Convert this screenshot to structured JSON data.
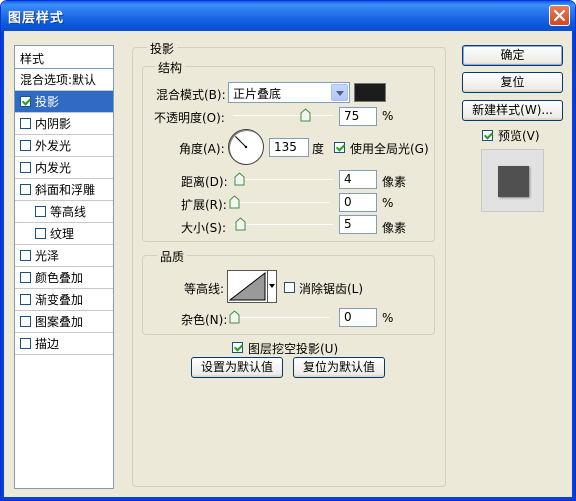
{
  "window": {
    "title": "图层样式"
  },
  "style_list": {
    "header": "样式",
    "blend_options": "混合选项:默认",
    "items": [
      {
        "label": "投影",
        "checked": true,
        "selected": true,
        "indent": false
      },
      {
        "label": "内阴影",
        "checked": false,
        "selected": false,
        "indent": false
      },
      {
        "label": "外发光",
        "checked": false,
        "selected": false,
        "indent": false
      },
      {
        "label": "内发光",
        "checked": false,
        "selected": false,
        "indent": false
      },
      {
        "label": "斜面和浮雕",
        "checked": false,
        "selected": false,
        "indent": false
      },
      {
        "label": "等高线",
        "checked": false,
        "selected": false,
        "indent": true
      },
      {
        "label": "纹理",
        "checked": false,
        "selected": false,
        "indent": true
      },
      {
        "label": "光泽",
        "checked": false,
        "selected": false,
        "indent": false
      },
      {
        "label": "颜色叠加",
        "checked": false,
        "selected": false,
        "indent": false
      },
      {
        "label": "渐变叠加",
        "checked": false,
        "selected": false,
        "indent": false
      },
      {
        "label": "图案叠加",
        "checked": false,
        "selected": false,
        "indent": false
      },
      {
        "label": "描边",
        "checked": false,
        "selected": false,
        "indent": false
      }
    ]
  },
  "drop_shadow": {
    "title": "投影",
    "structure": {
      "title": "结构",
      "blend_mode_label": "混合模式(B):",
      "blend_mode_value": "正片叠底",
      "shadow_color": "#1c1c1c",
      "opacity_label": "不透明度(O):",
      "opacity_value": "75",
      "opacity_unit": "%",
      "opacity_level": 75,
      "angle_label": "角度(A):",
      "angle_value": "135",
      "angle_unit": "度",
      "global_light_label": "使用全局光(G)",
      "global_light_checked": true,
      "distance_label": "距离(D):",
      "distance_value": "4",
      "distance_unit": "像素",
      "distance_level": 4,
      "spread_label": "扩展(R):",
      "spread_value": "0",
      "spread_unit": "%",
      "spread_level": 0,
      "size_label": "大小(S):",
      "size_value": "5",
      "size_unit": "像素",
      "size_level": 5
    },
    "quality": {
      "title": "品质",
      "contour_label": "等高线:",
      "anti_alias_label": "消除锯齿(L)",
      "anti_alias_checked": false,
      "noise_label": "杂色(N):",
      "noise_value": "0",
      "noise_unit": "%",
      "noise_level": 0
    },
    "knockout_label": "图层挖空投影(U)",
    "knockout_checked": true,
    "make_default_label": "设置为默认值",
    "reset_default_label": "复位为默认值"
  },
  "buttons": {
    "ok": "确定",
    "reset": "复位",
    "new_style": "新建样式(W)...",
    "preview_label": "预览(V)",
    "preview_checked": true
  },
  "icons": {
    "close": "close-icon",
    "angle_dial": "angle-dial-icon",
    "contour": "contour-curve-icon",
    "slider_thumb": "slider-thumb-icon"
  }
}
